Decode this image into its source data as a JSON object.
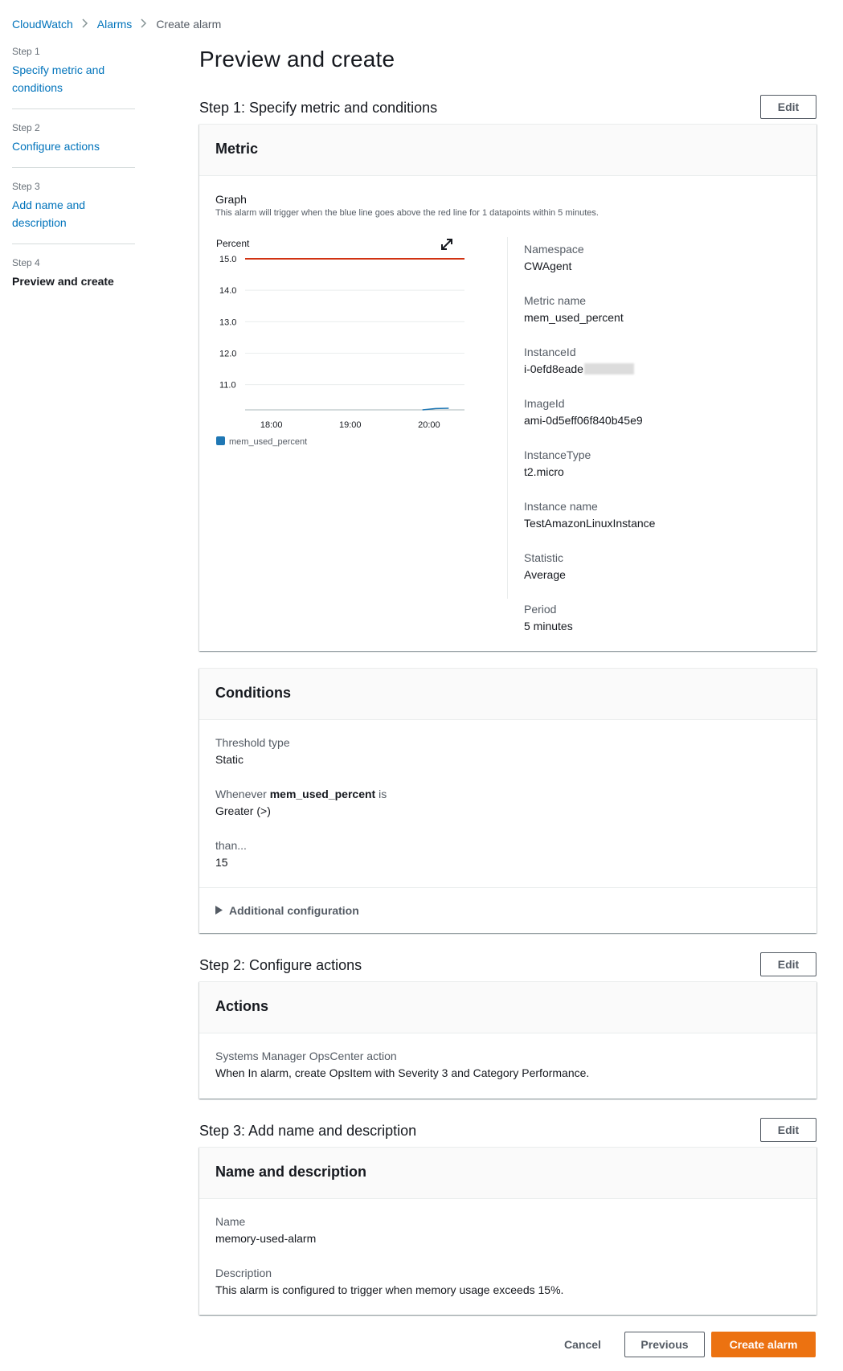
{
  "breadcrumb": {
    "items": [
      "CloudWatch",
      "Alarms"
    ],
    "current": "Create alarm"
  },
  "sidebar": {
    "steps": [
      {
        "num": "Step 1",
        "label": "Specify metric and conditions"
      },
      {
        "num": "Step 2",
        "label": "Configure actions"
      },
      {
        "num": "Step 3",
        "label": "Add name and description"
      },
      {
        "num": "Step 4",
        "label": "Preview and create"
      }
    ]
  },
  "page": {
    "title": "Preview and create"
  },
  "step1": {
    "title": "Step 1: Specify metric and conditions",
    "edit": "Edit",
    "metric_panel": {
      "heading": "Metric",
      "graph_title": "Graph",
      "graph_sub": "This alarm will trigger when the blue line goes above the red line for 1 datapoints within 5 minutes.",
      "details": [
        {
          "label": "Namespace",
          "value": "CWAgent"
        },
        {
          "label": "Metric name",
          "value": "mem_used_percent"
        },
        {
          "label": "InstanceId",
          "value": "i-0efd8eade"
        },
        {
          "label": "ImageId",
          "value": "ami-0d5eff06f840b45e9"
        },
        {
          "label": "InstanceType",
          "value": "t2.micro"
        },
        {
          "label": "Instance name",
          "value": "TestAmazonLinuxInstance"
        },
        {
          "label": "Statistic",
          "value": "Average"
        },
        {
          "label": "Period",
          "value": "5 minutes"
        }
      ]
    },
    "conditions_panel": {
      "heading": "Conditions",
      "threshold_type_label": "Threshold type",
      "threshold_type_value": "Static",
      "whenever_prefix": "Whenever",
      "whenever_metric": "mem_used_percent",
      "whenever_suffix": "is",
      "whenever_value": "Greater (>)",
      "than_label": "than...",
      "than_value": "15",
      "additional": "Additional configuration"
    }
  },
  "step2": {
    "title": "Step 2: Configure actions",
    "edit": "Edit",
    "panel_heading": "Actions",
    "action_label": "Systems Manager OpsCenter action",
    "action_value": "When In alarm, create OpsItem with Severity 3 and Category Performance."
  },
  "step3": {
    "title": "Step 3: Add name and description",
    "edit": "Edit",
    "panel_heading": "Name and description",
    "name_label": "Name",
    "name_value": "memory-used-alarm",
    "desc_label": "Description",
    "desc_value": "This alarm is configured to trigger when memory usage exceeds 15%."
  },
  "footer": {
    "cancel": "Cancel",
    "previous": "Previous",
    "create": "Create alarm"
  },
  "chart_data": {
    "type": "line",
    "ylabel": "Percent",
    "y_ticks": [
      "15.0",
      "14.0",
      "13.0",
      "12.0",
      "11.0"
    ],
    "ylim": [
      10.2,
      15.0
    ],
    "x_ticks": [
      "18:00",
      "19:00",
      "20:00"
    ],
    "threshold": {
      "value": 15,
      "color": "#d13212"
    },
    "series": [
      {
        "name": "mem_used_percent",
        "color": "#1f77b4",
        "values": [
          10.2,
          10.24,
          10.25
        ],
        "x": [
          "19:55",
          "20:05",
          "20:15"
        ]
      }
    ],
    "grid": true,
    "legend": "bottom-left"
  },
  "colors": {
    "accent": "#0073bb",
    "primary_button": "#ec7211",
    "threshold": "#d13212",
    "series": "#1f77b4"
  }
}
